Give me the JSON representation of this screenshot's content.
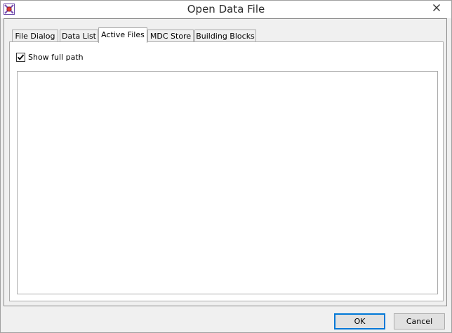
{
  "window": {
    "title": "Open Data File",
    "close_label": "×"
  },
  "tabs": [
    {
      "label": "File Dialog",
      "active": false
    },
    {
      "label": "Data List",
      "active": false
    },
    {
      "label": "Active Files",
      "active": true
    },
    {
      "label": "MDC Store",
      "active": false
    },
    {
      "label": "Building Blocks",
      "active": false
    }
  ],
  "active_files": {
    "show_full_path_label": "Show full path",
    "show_full_path_checked": true,
    "files": []
  },
  "buttons": {
    "ok_label": "OK",
    "cancel_label": "Cancel"
  },
  "colors": {
    "accent": "#0078d7",
    "window_bg": "#f0f0f0",
    "panel_bg": "#ffffff",
    "border": "#acacac"
  },
  "icons": {
    "app": "sigmaplot-app-icon",
    "close": "close-icon",
    "check": "checkmark-icon"
  }
}
